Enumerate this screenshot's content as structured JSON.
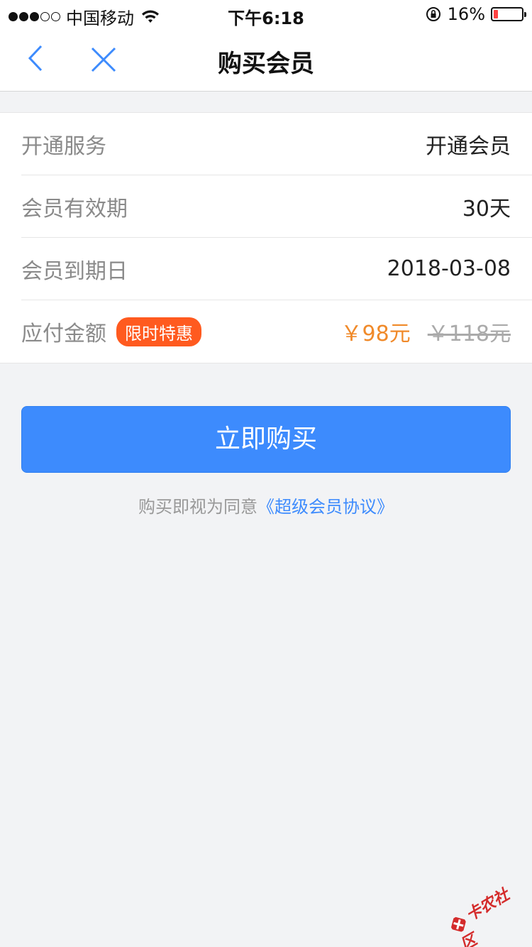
{
  "status_bar": {
    "carrier": "中国移动",
    "time": "下午6:18",
    "battery": "16%",
    "battery_level": 0.16
  },
  "nav": {
    "title": "购买会员"
  },
  "rows": [
    {
      "label": "开通服务",
      "value": "开通会员"
    },
    {
      "label": "会员有效期",
      "value": "30天"
    },
    {
      "label": "会员到期日",
      "value": "2018-03-08"
    },
    {
      "label": "应付金额",
      "badge": "限时特惠",
      "price_now": "￥98元",
      "price_old": "￥118元"
    }
  ],
  "buy_button": {
    "label": "立即购买"
  },
  "agreement": {
    "prefix": "购买即视为同意",
    "link": "《超级会员协议》"
  },
  "watermark": {
    "text": "卡农社区"
  },
  "colors": {
    "accent": "#3d8bfd",
    "badge": "#ff5a1f",
    "price": "#f08a2a",
    "battery_low": "#ff4444"
  }
}
